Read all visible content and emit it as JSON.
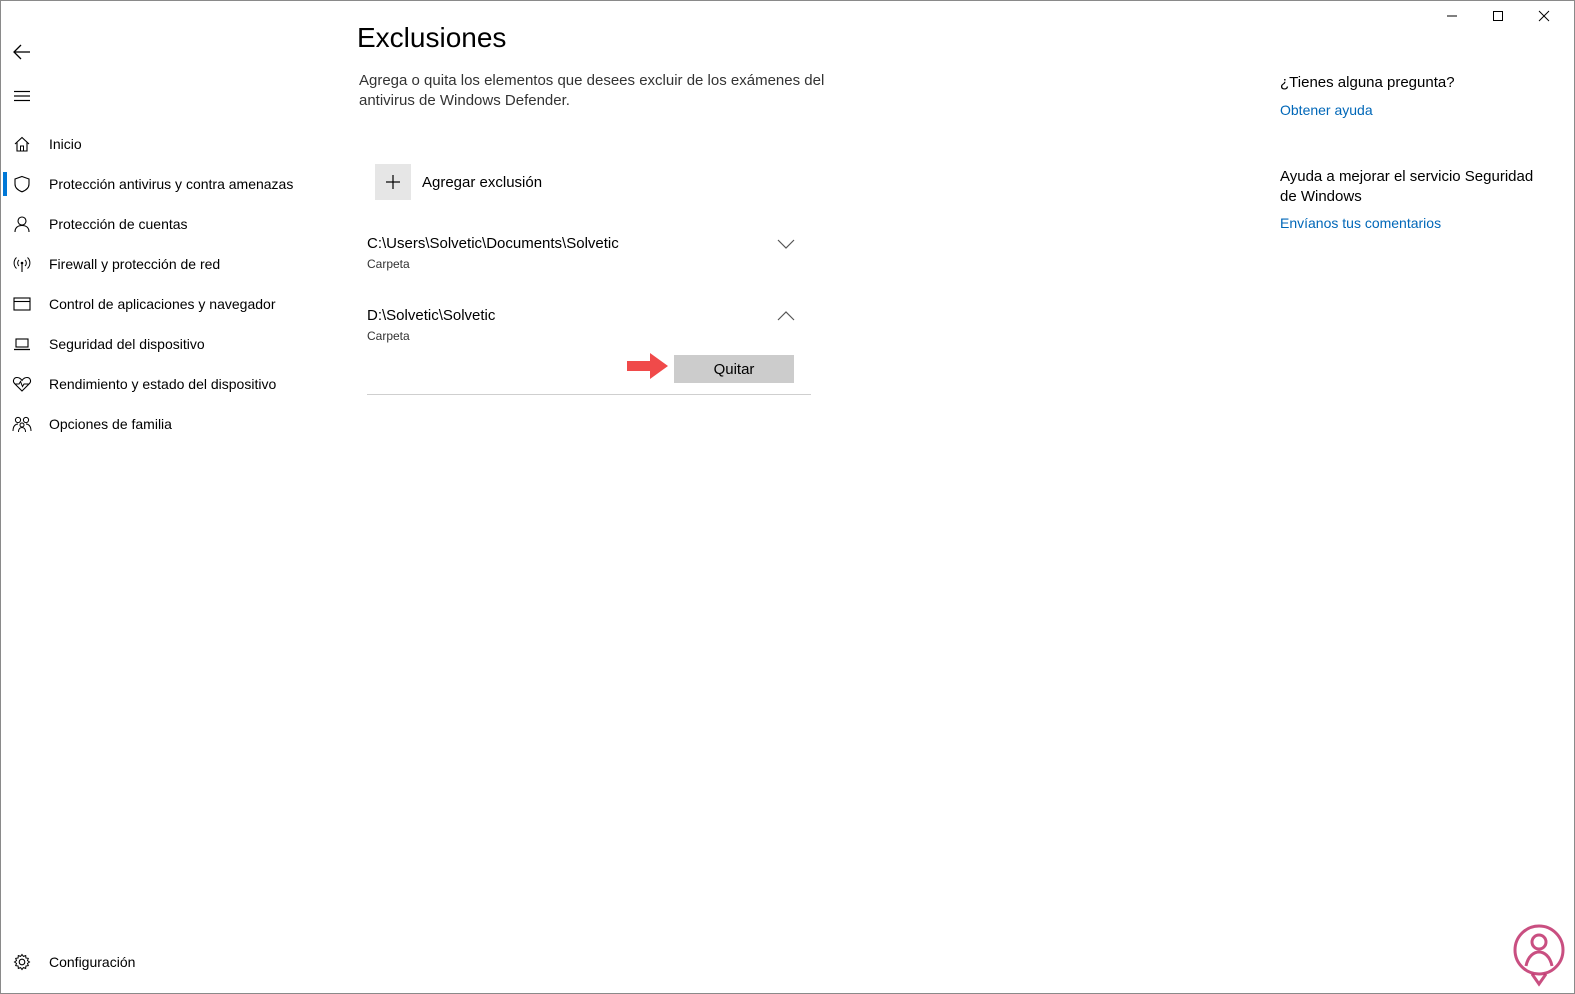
{
  "nav": {
    "back_icon": "back-arrow-icon",
    "menu_icon": "hamburger-icon",
    "items": [
      {
        "label": "Inicio",
        "icon": "home-icon"
      },
      {
        "label": "Protección antivirus y contra amenazas",
        "icon": "shield-icon",
        "selected": true
      },
      {
        "label": "Protección de cuentas",
        "icon": "person-icon"
      },
      {
        "label": "Firewall y protección de red",
        "icon": "antenna-icon"
      },
      {
        "label": "Control de aplicaciones y navegador",
        "icon": "browser-window-icon"
      },
      {
        "label": "Seguridad del dispositivo",
        "icon": "laptop-icon"
      },
      {
        "label": "Rendimiento y estado del dispositivo",
        "icon": "heart-pulse-icon"
      },
      {
        "label": "Opciones de familia",
        "icon": "family-icon"
      }
    ],
    "settings": {
      "label": "Configuración",
      "icon": "gear-icon"
    }
  },
  "main": {
    "title": "Exclusiones",
    "description": "Agrega o quita los elementos que desees excluir de los exámenes del antivirus de Windows Defender.",
    "add_label": "Agregar exclusión",
    "exclusions": [
      {
        "path": "C:\\Users\\Solvetic\\Documents\\Solvetic",
        "type": "Carpeta",
        "expanded": false
      },
      {
        "path": "D:\\Solvetic\\Solvetic",
        "type": "Carpeta",
        "expanded": true
      }
    ],
    "remove_label": "Quitar"
  },
  "side": {
    "question": "¿Tienes alguna pregunta?",
    "help_link": "Obtener ayuda",
    "improve_text": "Ayuda a mejorar el servicio Seguridad de Windows",
    "feedback_link": "Envíanos tus comentarios"
  },
  "colors": {
    "accent": "#0078d7",
    "link": "#0067b8",
    "annotation_arrow": "#f04a4a",
    "watermark": "#c0306b"
  }
}
